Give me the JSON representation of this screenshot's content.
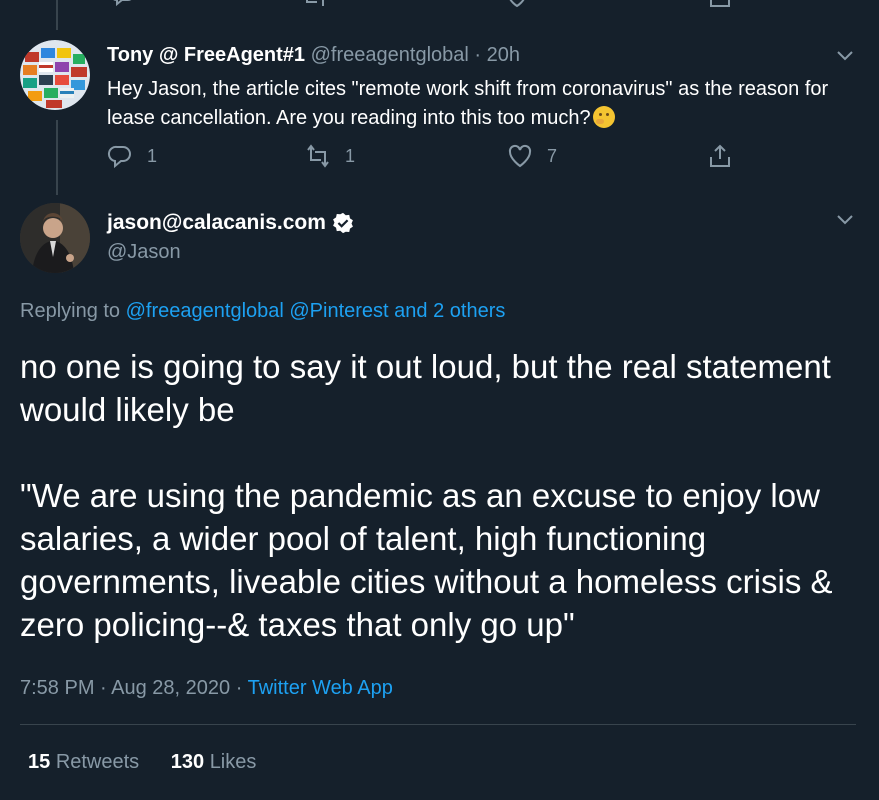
{
  "reply_tweet": {
    "display_name": "Tony @ FreeAgent#1",
    "handle": "@freeagentglobal",
    "separator": "·",
    "time": "20h",
    "text": "Hey Jason, the article cites \"remote work shift from coronavirus\" as the reason for lease cancellation. Are you reading into this too much?",
    "emoji_icon": "thinking-face-emoji",
    "reply_count": "1",
    "retweet_count": "1",
    "like_count": "7"
  },
  "main_tweet": {
    "display_name": "jason@calacanis.com",
    "handle": "@Jason",
    "replying_prefix": "Replying to",
    "replying_users": "@freeagentglobal @Pinterest and 2 others",
    "paragraph_1": "no one is going to say it out loud, but the real statement would likely be",
    "paragraph_2": "\"We are using the pandemic as an excuse to enjoy low salaries, a wider pool of talent, high functioning governments, liveable cities without a homeless crisis & zero policing--& taxes that only go up\"",
    "timestamp": "7:58 PM · Aug 28, 2020",
    "meta_separator": "·",
    "source": "Twitter Web App",
    "retweets_count": "15",
    "retweets_label": "Retweets",
    "likes_count": "130",
    "likes_label": "Likes"
  },
  "colors": {
    "background": "#15202b",
    "text": "#ffffff",
    "muted": "#8899a6",
    "link": "#1da1f2",
    "border": "#38444d"
  }
}
